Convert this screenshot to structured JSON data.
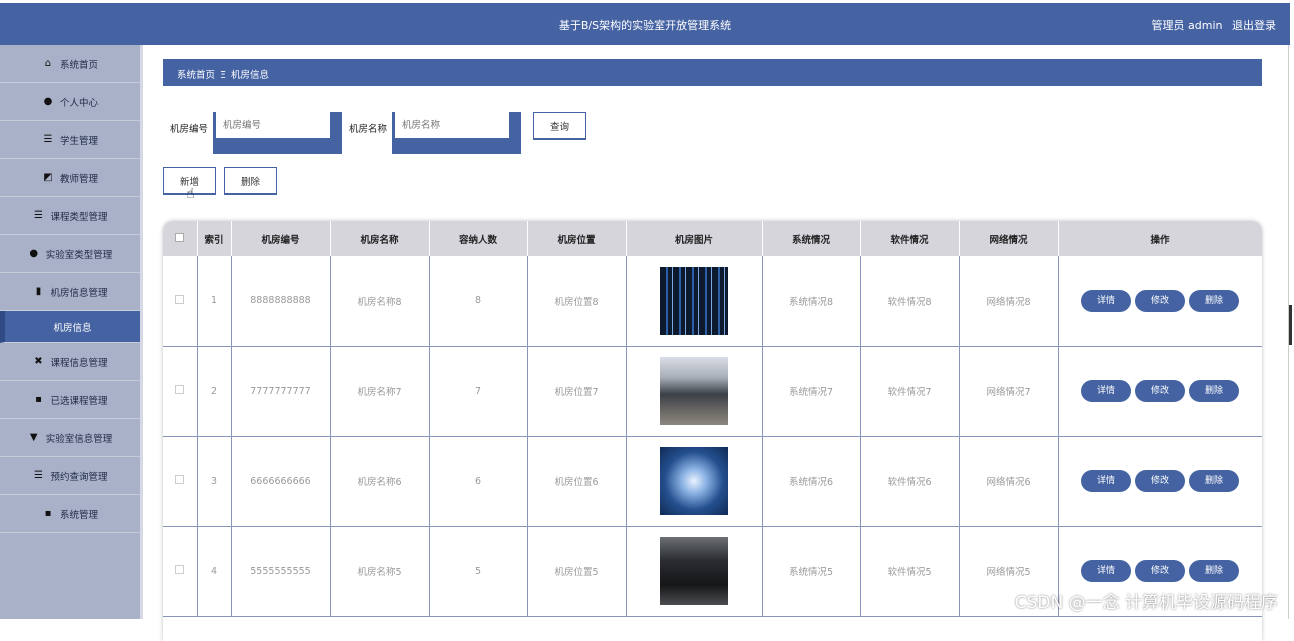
{
  "header": {
    "title": "基于B/S架构的实验室开放管理系统",
    "user": "管理员 admin",
    "logout": "退出登录"
  },
  "sidebar": {
    "items": [
      {
        "label": "系统首页",
        "icon": "home-icon",
        "glyph": "⌂"
      },
      {
        "label": "个人中心",
        "icon": "user-icon",
        "glyph": "●"
      },
      {
        "label": "学生管理",
        "icon": "list-icon",
        "glyph": "☰"
      },
      {
        "label": "教师管理",
        "icon": "chart-icon",
        "glyph": "◩"
      },
      {
        "label": "课程类型管理",
        "icon": "sliders-icon",
        "glyph": "☰"
      },
      {
        "label": "实验室类型管理",
        "icon": "user-icon",
        "glyph": "●"
      },
      {
        "label": "机房信息管理",
        "icon": "bar-chart-icon",
        "glyph": "▮"
      },
      {
        "label": "机房信息",
        "icon": "",
        "glyph": ""
      },
      {
        "label": "课程信息管理",
        "icon": "ticket-icon",
        "glyph": "✖"
      },
      {
        "label": "已选课程管理",
        "icon": "grid-icon",
        "glyph": "▪"
      },
      {
        "label": "实验室信息管理",
        "icon": "pin-icon",
        "glyph": "▼"
      },
      {
        "label": "预约查询管理",
        "icon": "list-icon",
        "glyph": "☰"
      },
      {
        "label": "系统管理",
        "icon": "grid-icon",
        "glyph": "▪"
      }
    ]
  },
  "breadcrumb": {
    "home": "系统首页",
    "separator": "Ξ",
    "current": "机房信息"
  },
  "search": {
    "label1": "机房编号",
    "placeholder1": "机房编号",
    "label2": "机房名称",
    "placeholder2": "机房名称",
    "button": "查询"
  },
  "actions": {
    "add": "新增",
    "delete": "删除"
  },
  "table": {
    "headers": [
      "索引",
      "机房编号",
      "机房名称",
      "容纳人数",
      "机房位置",
      "机房图片",
      "系统情况",
      "软件情况",
      "网络情况",
      "操作"
    ],
    "rows": [
      {
        "index": "1",
        "code": "8888888888",
        "name": "机房名称8",
        "capacity": "8",
        "location": "机房位置8",
        "system": "系统情况8",
        "software": "软件情况8",
        "network": "网络情况8"
      },
      {
        "index": "2",
        "code": "7777777777",
        "name": "机房名称7",
        "capacity": "7",
        "location": "机房位置7",
        "system": "系统情况7",
        "software": "软件情况7",
        "network": "网络情况7"
      },
      {
        "index": "3",
        "code": "6666666666",
        "name": "机房名称6",
        "capacity": "6",
        "location": "机房位置6",
        "system": "系统情况6",
        "software": "软件情况6",
        "network": "网络情况6"
      },
      {
        "index": "4",
        "code": "5555555555",
        "name": "机房名称5",
        "capacity": "5",
        "location": "机房位置5",
        "system": "系统情况5",
        "software": "软件情况5",
        "network": "网络情况5"
      }
    ],
    "ops": {
      "detail": "详情",
      "edit": "修改",
      "delete": "删除"
    }
  },
  "watermark": "CSDN @一念 计算机毕设源码程序",
  "colors": {
    "primary": "#4563a3",
    "sidebar": "#a8b1c7",
    "table_header": "#d7d5dc"
  }
}
